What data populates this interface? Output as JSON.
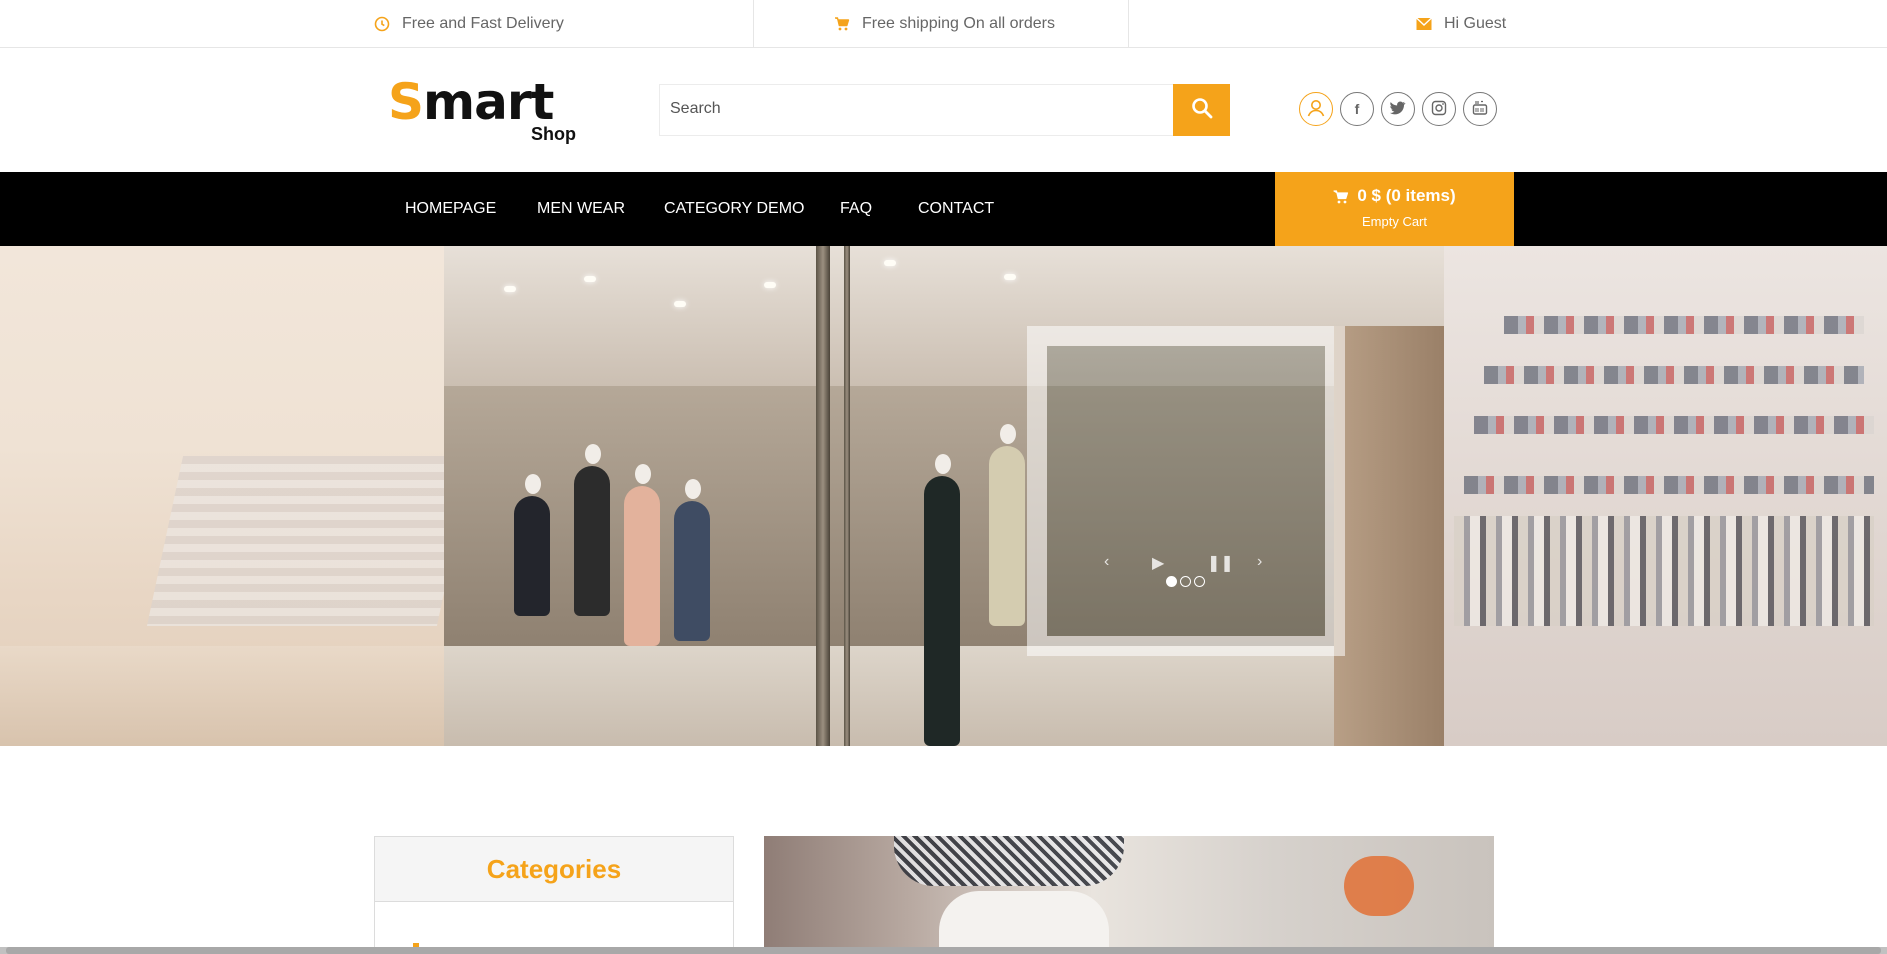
{
  "topbar": {
    "delivery": "Free and Fast Delivery",
    "shipping": "Free shipping On all orders",
    "greeting": "Hi Guest"
  },
  "header": {
    "logo_main": "mart",
    "logo_initial": "S",
    "logo_sub": "Shop",
    "search_placeholder": "Search",
    "social": [
      "user-icon",
      "facebook-icon",
      "twitter-icon",
      "instagram-icon",
      "youtube-icon"
    ]
  },
  "nav": {
    "items": [
      "HOMEPAGE",
      "MEN WEAR",
      "CATEGORY DEMO",
      "FAQ",
      "CONTACT"
    ]
  },
  "cart": {
    "summary": "0 $ (0 items)",
    "status": "Empty Cart"
  },
  "slider": {
    "slides": 3,
    "active_index": 0
  },
  "sidebar": {
    "categories_title": "Categories"
  },
  "colors": {
    "accent": "#f5a31a",
    "nav_bg": "#000000"
  }
}
